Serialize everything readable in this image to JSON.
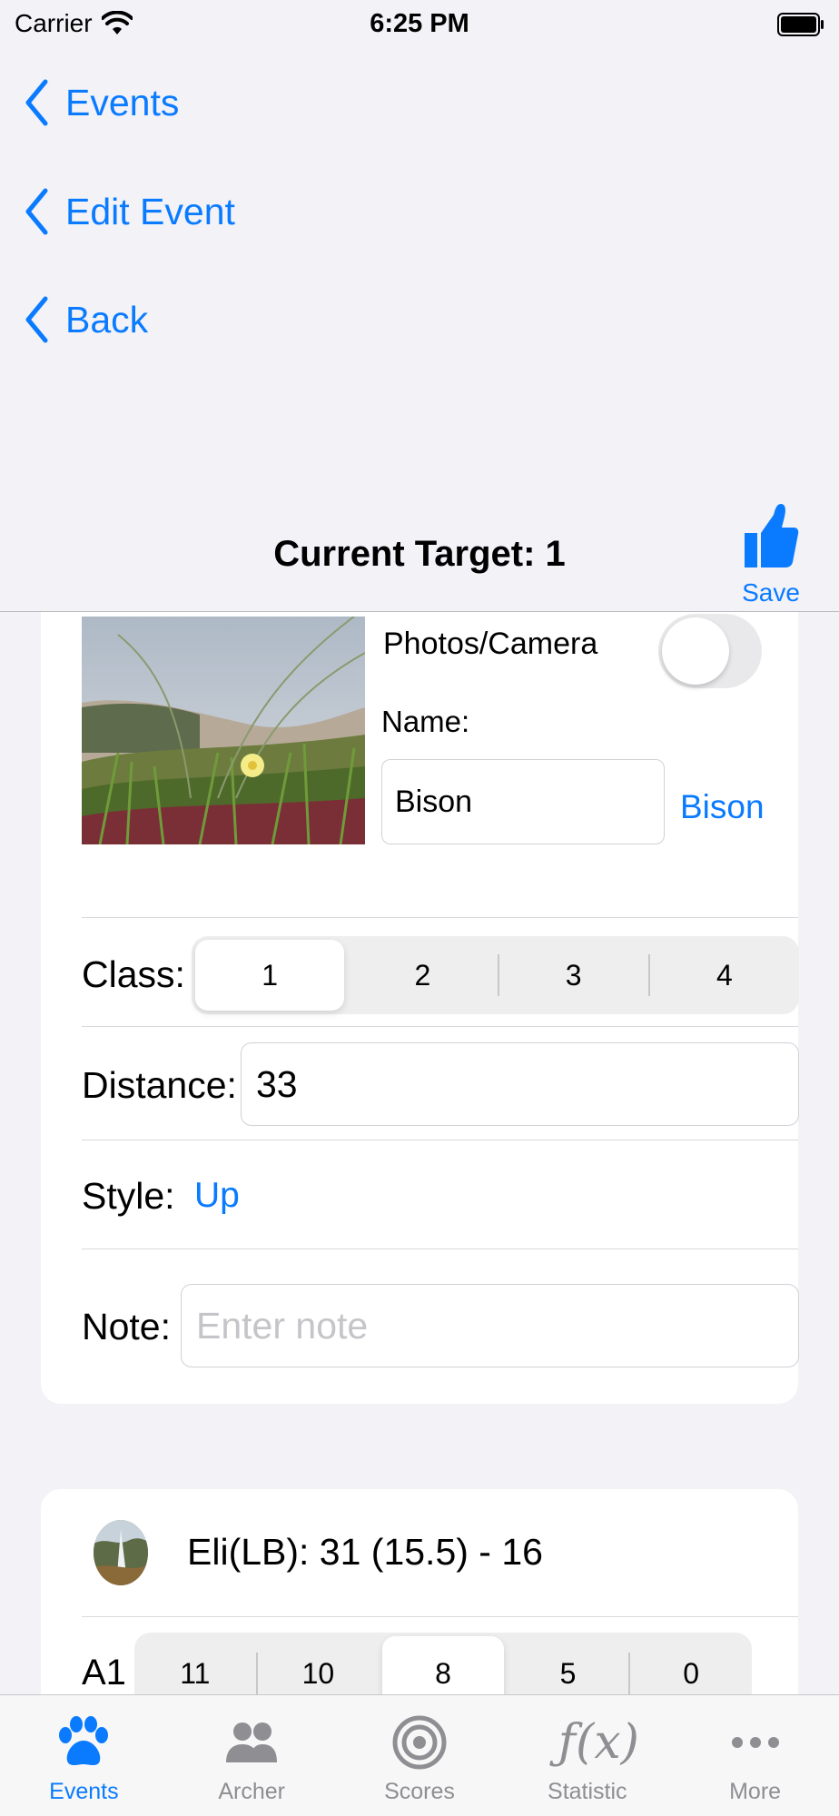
{
  "status_bar": {
    "carrier": "Carrier",
    "time": "6:25 PM"
  },
  "back_links": [
    "Events",
    "Edit Event",
    "Back"
  ],
  "header": {
    "title": "Current Target: 1",
    "save_label": "Save"
  },
  "target": {
    "photos_label": "Photos/Camera",
    "photos_toggle_on": false,
    "name_label": "Name:",
    "name_value": "Bison",
    "name_link": "Bison",
    "class_label": "Class:",
    "class_options": [
      "1",
      "2",
      "3",
      "4"
    ],
    "class_selected": "1",
    "distance_label": "Distance:",
    "distance_value": "33",
    "style_label": "Style:",
    "style_value": "Up",
    "note_label": "Note:",
    "note_placeholder": "Enter note"
  },
  "archer": {
    "summary": "Eli(LB): 31 (15.5) - 16",
    "round_label": "A1",
    "score_options": [
      "11",
      "10",
      "8",
      "5",
      "0"
    ],
    "score_selected": "8"
  },
  "tab_bar": {
    "items": [
      {
        "label": "Events",
        "icon": "paw-icon"
      },
      {
        "label": "Archer",
        "icon": "people-icon"
      },
      {
        "label": "Scores",
        "icon": "target-icon"
      },
      {
        "label": "Statistic",
        "icon": "fx-icon"
      },
      {
        "label": "More",
        "icon": "more-icon"
      }
    ],
    "active": "Events",
    "active_color": "#0a7bff",
    "inactive_color": "#8e8e93"
  }
}
